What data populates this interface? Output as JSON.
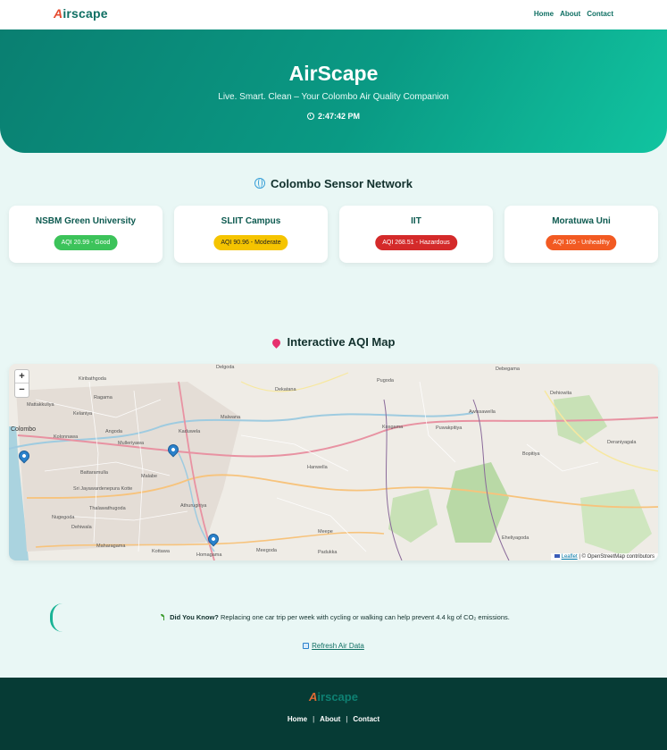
{
  "nav": {
    "brand_first": "A",
    "brand_rest": "irscape",
    "links": [
      "Home",
      "About",
      "Contact"
    ]
  },
  "hero": {
    "title": "AirScape",
    "subtitle": "Live. Smart. Clean – Your Colombo Air Quality Companion",
    "time": "2:47:42 PM",
    "time_icon": "clock-icon"
  },
  "sensors": {
    "heading": "Colombo Sensor Network",
    "heading_icon": "globe-icon",
    "items": [
      {
        "name": "NSBM Green University",
        "aqi": "AQI 20.99 - Good",
        "color": "#3cc35a",
        "text_color": "#ffffff"
      },
      {
        "name": "SLIIT Campus",
        "aqi": "AQI 90.96 - Moderate",
        "color": "#f5c400",
        "text_color": "#222222"
      },
      {
        "name": "IIT",
        "aqi": "AQI 268.51 - Hazardous",
        "color": "#d42a2a",
        "text_color": "#ffffff"
      },
      {
        "name": "Moratuwa Uni",
        "aqi": "AQI 105 - Unhealthy",
        "color": "#f25a22",
        "text_color": "#ffffff"
      }
    ]
  },
  "map": {
    "heading": "Interactive AQI Map",
    "heading_icon": "map-pin-icon",
    "zoom_in": "+",
    "zoom_out": "−",
    "attribution_leaflet": "Leaflet",
    "attribution_rest": "| © OpenStreetMap contributors",
    "labels": [
      "Delgoda",
      "Dekatana",
      "Pugoda",
      "Debegama",
      "Dehiowita",
      "Kiribathgoda",
      "Malwana",
      "Kaduwela",
      "Colombo",
      "Kolonnawa",
      "Mulleriyawa",
      "Hanwella",
      "Kosgama",
      "Awissawella",
      "Puwakpitiya",
      "Deraniyagala",
      "Sri Jayawardenepura Kotte",
      "Malabe",
      "Athurugiriya",
      "Thalawathugoda",
      "Nugegoda",
      "Dehiwala",
      "Maharagama",
      "Kottawa",
      "Homagama",
      "Meegoda",
      "Padukka",
      "Meepe",
      "Eheliyagoda",
      "Angoda",
      "Battaramulla",
      "Bopitiya",
      "Kelaniya",
      "Mattakkuliya",
      "Ragama"
    ]
  },
  "tip": {
    "icon": "sprout-icon",
    "label": "Did You Know?",
    "text": "Replacing one car trip per week with cycling or walking can help prevent 4.4 kg of CO₂ emissions."
  },
  "refresh": {
    "icon": "refresh-icon",
    "label": "Refresh Air Data"
  },
  "footer": {
    "brand_first": "A",
    "brand_rest": "irscape",
    "links": [
      "Home",
      "About",
      "Contact"
    ],
    "separator": "|"
  }
}
